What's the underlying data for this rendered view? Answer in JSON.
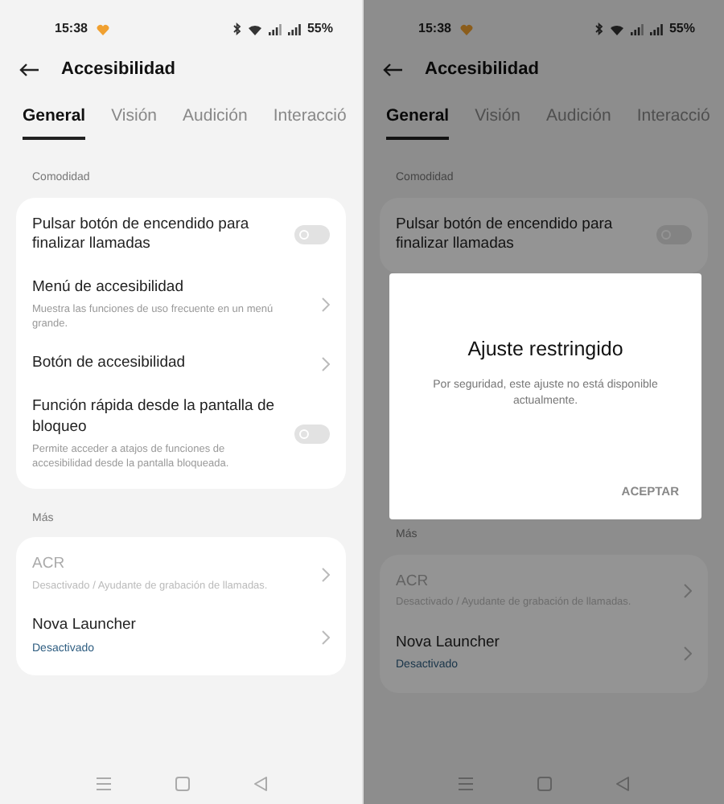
{
  "screens": [
    {
      "dimmed": false,
      "status_bar": {
        "time": "15:38",
        "battery": "55%"
      },
      "title": "Accesibilidad",
      "tabs": [
        {
          "label": "General",
          "selected": true
        },
        {
          "label": "Visión",
          "selected": false
        },
        {
          "label": "Audición",
          "selected": false
        },
        {
          "label": "Interacció",
          "selected": false
        }
      ],
      "sections": [
        {
          "heading": "Comodidad",
          "items": [
            {
              "kind": "switch",
              "title": "Pulsar botón de encendido para finalizar llamadas",
              "on": false,
              "disabled": false
            },
            {
              "kind": "link",
              "title": "Menú de accesibilidad",
              "description": "Muestra las funciones de uso frecuente en un menú grande.",
              "disabled": false
            },
            {
              "kind": "link",
              "title": "Botón de accesibilidad",
              "disabled": false
            },
            {
              "kind": "switch",
              "title": "Función rápida desde la pantalla de bloqueo",
              "description": "Permite acceder a atajos de funciones de accesibilidad desde la pantalla bloqueada.",
              "on": false,
              "disabled": false
            }
          ]
        },
        {
          "heading": "Más",
          "items": [
            {
              "kind": "link",
              "title": "ACR",
              "description": "Desactivado / Ayudante de grabación de llamadas.",
              "disabled": true
            },
            {
              "kind": "link",
              "title": "Nova Launcher",
              "status": "Desactivado",
              "disabled": false
            }
          ]
        }
      ]
    },
    {
      "dimmed": true,
      "status_bar": {
        "time": "15:38",
        "battery": "55%"
      },
      "title": "Accesibilidad",
      "tabs": [
        {
          "label": "General",
          "selected": true
        },
        {
          "label": "Visión",
          "selected": false
        },
        {
          "label": "Audición",
          "selected": false
        },
        {
          "label": "Interacció",
          "selected": false
        }
      ],
      "sections": [
        {
          "heading": "Comodidad",
          "items": [
            {
              "kind": "switch",
              "title": "Pulsar botón de encendido para finalizar llamadas",
              "on": false,
              "disabled": false
            }
          ]
        },
        {
          "heading": "Más",
          "items": [
            {
              "kind": "link",
              "title": "ACR",
              "description": "Desactivado / Ayudante de grabación de llamadas.",
              "disabled": true
            },
            {
              "kind": "link",
              "title": "Nova Launcher",
              "status": "Desactivado",
              "disabled": false
            }
          ]
        }
      ],
      "dialog": {
        "title": "Ajuste restringido",
        "message": "Por seguridad, este ajuste no está disponible actualmente.",
        "button": "ACEPTAR"
      }
    }
  ]
}
